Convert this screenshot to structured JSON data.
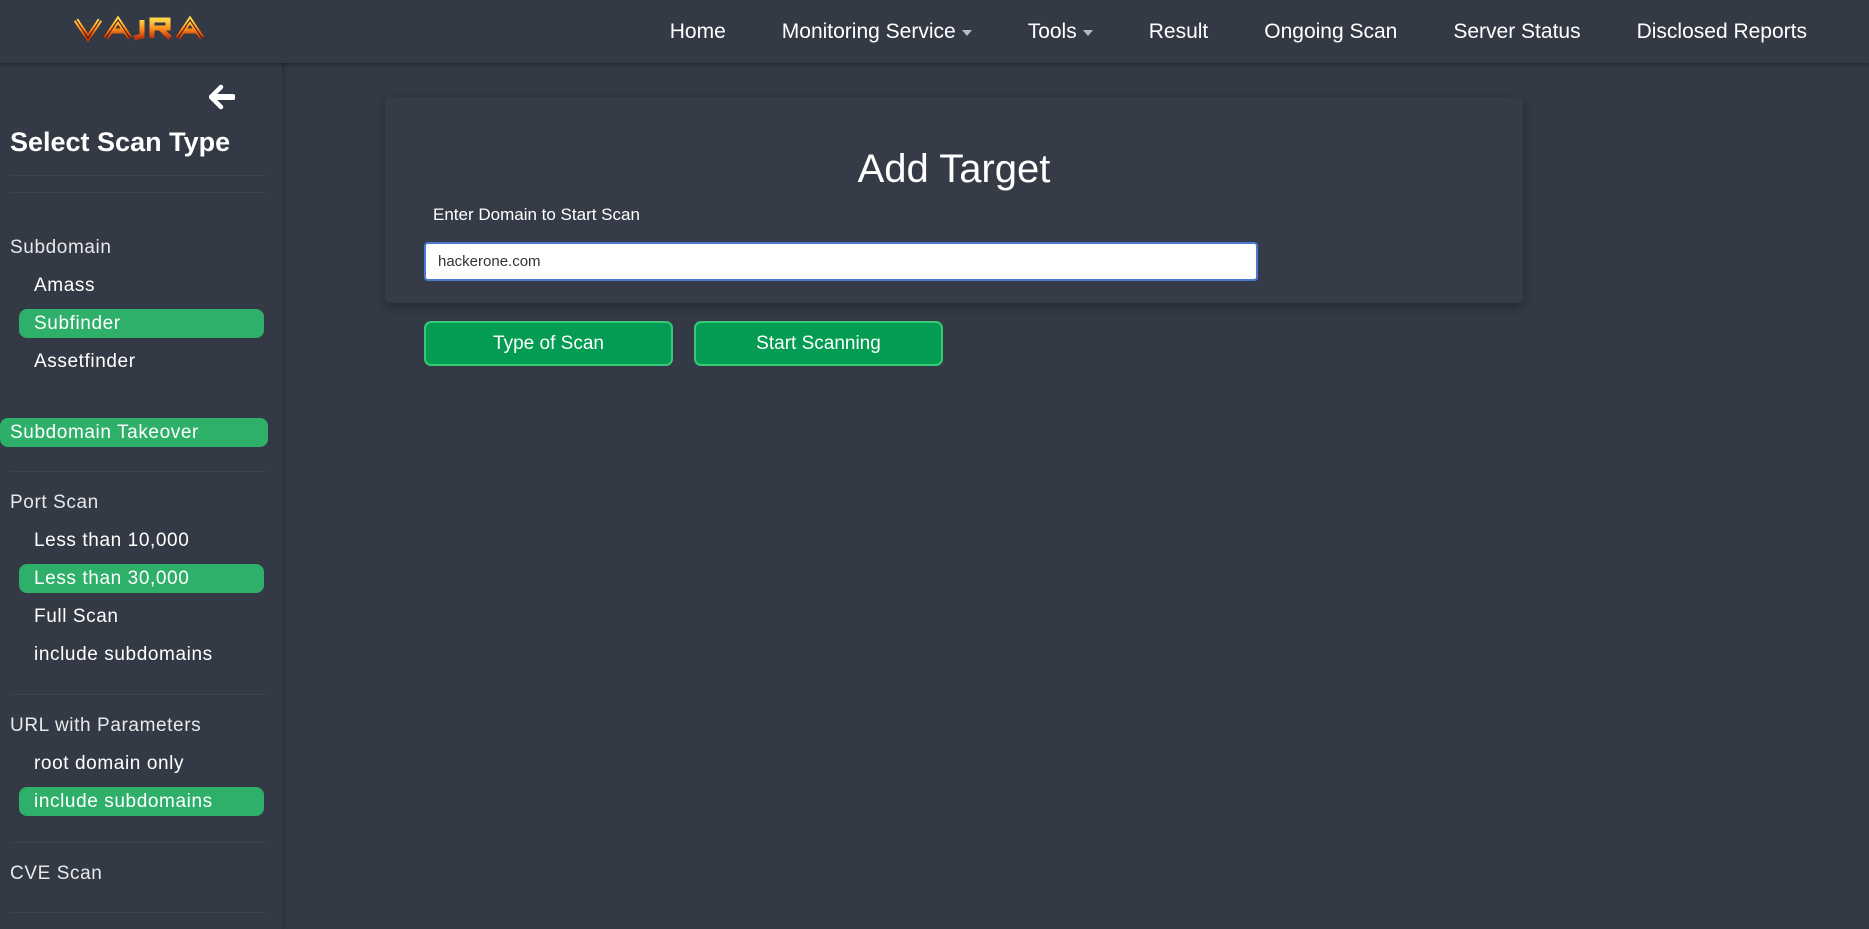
{
  "brand": {
    "logo_text": "VAJRA"
  },
  "nav": {
    "items": [
      {
        "label": "Home",
        "dropdown": false
      },
      {
        "label": "Monitoring Service",
        "dropdown": true
      },
      {
        "label": "Tools",
        "dropdown": true
      },
      {
        "label": "Result",
        "dropdown": false
      },
      {
        "label": "Ongoing Scan",
        "dropdown": false
      },
      {
        "label": "Server Status",
        "dropdown": false
      },
      {
        "label": "Disclosed Reports",
        "dropdown": false
      }
    ]
  },
  "sidebar": {
    "title": "Select Scan Type",
    "back_icon": "arrow-left-icon",
    "subdomain": {
      "header": "Subdomain",
      "items": [
        "Amass",
        "Subfinder",
        "Assetfinder"
      ],
      "selected": "Subfinder"
    },
    "takeover": {
      "label": "Subdomain Takeover",
      "selected": true
    },
    "port_scan": {
      "header": "Port Scan",
      "items": [
        "Less than 10,000",
        "Less than 30,000",
        "Full Scan",
        "include subdomains"
      ],
      "selected": "Less than 30,000"
    },
    "url_params": {
      "header": "URL with Parameters",
      "items": [
        "root domain only",
        "include subdomains"
      ],
      "selected": "include subdomains"
    },
    "cve": {
      "header": "CVE Scan"
    }
  },
  "main": {
    "title": "Add Target",
    "input_label": "Enter Domain to Start Scan",
    "input_value": "hackerone.com",
    "buttons": {
      "type_of_scan": "Type of Scan",
      "start_scanning": "Start Scanning"
    }
  },
  "colors": {
    "background": "#343a45",
    "accent_green": "#2fb06a",
    "button_green": "#049c52",
    "input_focus_border": "#4a7bd1"
  }
}
